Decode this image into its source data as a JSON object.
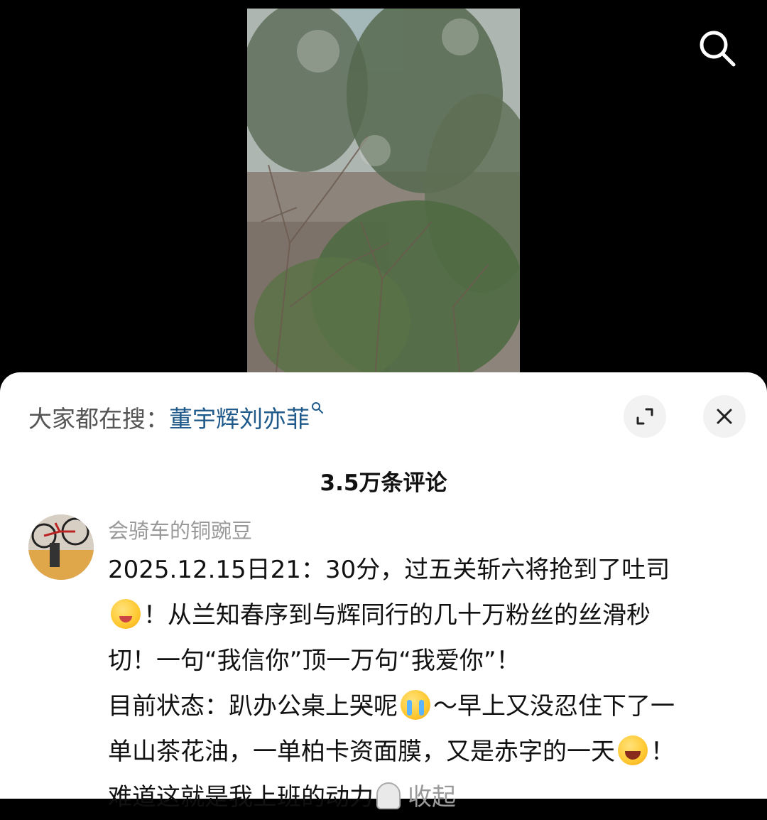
{
  "video": {
    "search_icon": "search-icon"
  },
  "sheet": {
    "trending_prefix": "大家都在搜：",
    "trending_query": "董宇辉刘亦菲",
    "expand_icon": "expand-icon",
    "close_icon": "close-icon",
    "comment_count": "3.5万条评论"
  },
  "comment": {
    "username": "会骑车的铜豌豆",
    "lines": {
      "l1": "2025.12.15日21：30分，过五关斩六将抢到了吐司",
      "l2": "！从兰知春序到与辉同行的几十万粉丝的丝滑秒",
      "l3": "切！一句“我信你”顶一万句“我爱你”！",
      "l4a": "目前状态：趴办公桌上哭呢",
      "l4b": "～早上又没忍住下了一",
      "l5a": "单山茶花油，一单柏卡资面膜，又是赤字的一天",
      "l5b": "！",
      "l6": "难道这就是我上班的动力"
    },
    "collapse_label": "收起",
    "emojis": [
      "wink-laugh-emoji",
      "crying-emoji",
      "laughing-tears-emoji",
      "ghost-emoji"
    ]
  }
}
